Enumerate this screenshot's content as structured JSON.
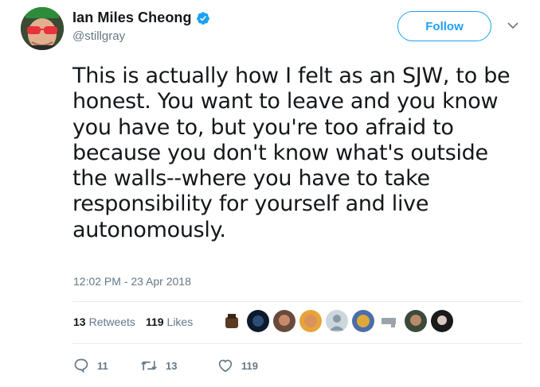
{
  "author": {
    "display_name": "Ian Miles Cheong",
    "handle": "@stillgray",
    "verified": true,
    "avatar_icon": "avatar-icon"
  },
  "follow": {
    "label": "Follow",
    "color": "#1da1f2"
  },
  "tweet": {
    "lines": [
      "This is actually how I felt as an SJW, to be",
      "honest. You want to leave and you know",
      "you have to, but you're too afraid to",
      "because you don't know what's outside",
      "the walls--where you have to take",
      "responsibility for yourself and live",
      "autonomously."
    ],
    "timestamp": "12:02 PM - 23 Apr 2018"
  },
  "stats": {
    "retweets_count": "13",
    "retweets_label": "Retweets",
    "likes_count": "119",
    "likes_label": "Likes"
  },
  "actions": {
    "reply_count": "11",
    "retweet_count": "13",
    "like_count": "119"
  },
  "colors": {
    "text": "#14171a",
    "secondary": "#657786",
    "accent": "#1da1f2",
    "divider": "#e6ecf0"
  }
}
